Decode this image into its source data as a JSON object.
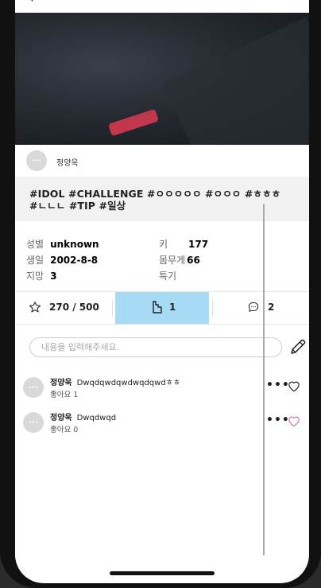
{
  "post": {
    "author": "정양욱",
    "tags": "#IDOL #CHALLENGE #ㅇㅇㅇㅇㅇ #ㅇㅇㅇ #ㅎㅎㅎ #ㄴㄴㄴ #TIP #일상"
  },
  "avatar_text": "•••",
  "profile": {
    "gender_label": "성별",
    "gender_value": "unknown",
    "birth_label": "생일",
    "birth_value": "2002-8-8",
    "aspire_label": "지망",
    "aspire_value": "3",
    "height_label": "키",
    "height_value": "177",
    "weight_label": "몸무게",
    "weight_value": "66",
    "special_label": "특기",
    "special_value": ""
  },
  "stats": {
    "stars": "270 / 500",
    "shares": "1",
    "comments": "2"
  },
  "comment_input": {
    "placeholder": "내용을 입력해주세요."
  },
  "comments": [
    {
      "author": "정양욱",
      "text": "Dwqdqwdqwdwqdqwdㅎㅎ",
      "likes_label": "좋아요 1",
      "liked": false
    },
    {
      "author": "정양욱",
      "text": "Dwqdwqd",
      "likes_label": "좋아요 0",
      "liked": false
    }
  ],
  "colors": {
    "share_highlight": "#a8dcf6",
    "heart_pink": "#e46f8d",
    "strap_red": "#c2374b"
  },
  "icons": {
    "back": "chevron-left-icon",
    "star": "star-icon",
    "share": "share-icon",
    "comment": "speech-bubble-icon",
    "pencil": "pencil-icon",
    "heart": "heart-icon",
    "more": "more-icon"
  }
}
